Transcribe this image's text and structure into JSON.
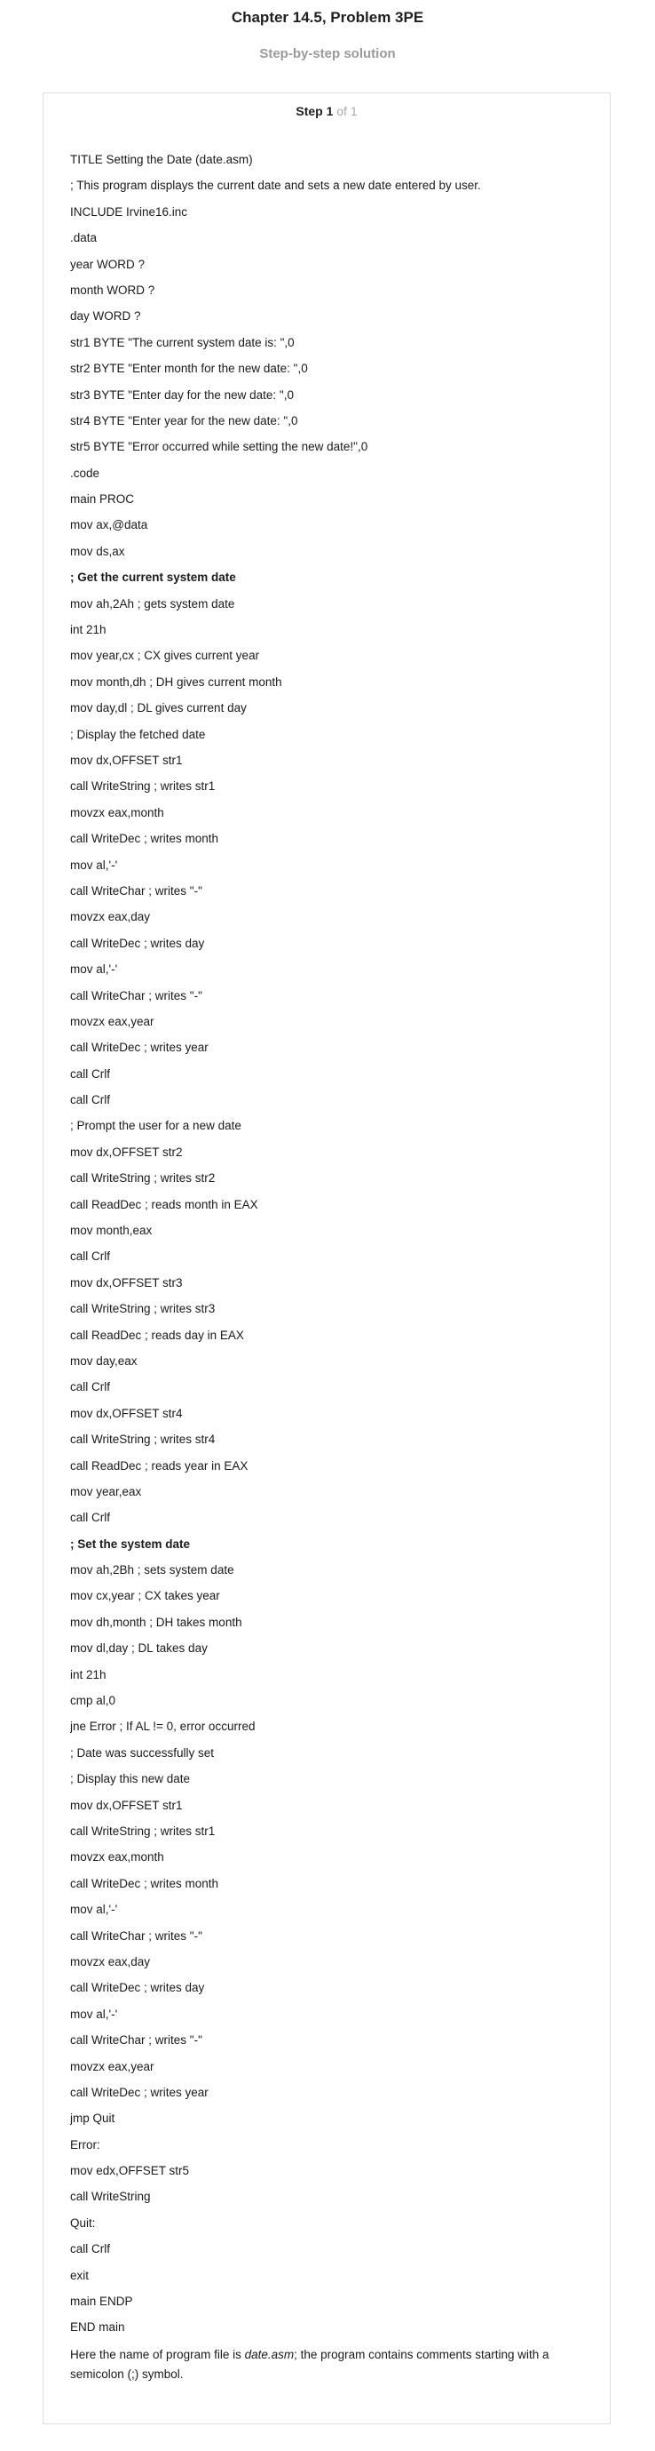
{
  "header": {
    "title": "Chapter 14.5, Problem 3PE",
    "subtitle": "Step-by-step solution"
  },
  "step": {
    "label": "Step 1",
    "of_text": " of 1"
  },
  "code_lines": [
    {
      "text": "TITLE Setting the Date (date.asm)",
      "bold": false
    },
    {
      "text": "; This program displays the current date and sets a new date entered by user.",
      "bold": false
    },
    {
      "text": "INCLUDE Irvine16.inc",
      "bold": false
    },
    {
      "text": ".data",
      "bold": false
    },
    {
      "text": "year WORD ?",
      "bold": false
    },
    {
      "text": "month WORD ?",
      "bold": false
    },
    {
      "text": "day WORD ?",
      "bold": false
    },
    {
      "text": "str1 BYTE \"The current system date is: \",0",
      "bold": false
    },
    {
      "text": "str2 BYTE \"Enter month for the new date: \",0",
      "bold": false
    },
    {
      "text": "str3 BYTE \"Enter day for the new date: \",0",
      "bold": false
    },
    {
      "text": "str4 BYTE \"Enter year for the new date: \",0",
      "bold": false
    },
    {
      "text": "str5 BYTE \"Error occurred while setting the new date!\",0",
      "bold": false
    },
    {
      "text": ".code",
      "bold": false
    },
    {
      "text": "main PROC",
      "bold": false
    },
    {
      "text": "mov ax,@data",
      "bold": false
    },
    {
      "text": "mov ds,ax",
      "bold": false
    },
    {
      "text": "; Get the current system date",
      "bold": true
    },
    {
      "text": "mov ah,2Ah ; gets system date",
      "bold": false
    },
    {
      "text": "int 21h",
      "bold": false
    },
    {
      "text": "mov year,cx ; CX gives current year",
      "bold": false
    },
    {
      "text": "mov month,dh ; DH gives current month",
      "bold": false
    },
    {
      "text": "mov day,dl ; DL gives current day",
      "bold": false
    },
    {
      "text": "; Display the fetched date",
      "bold": false
    },
    {
      "text": "mov dx,OFFSET str1",
      "bold": false
    },
    {
      "text": "call WriteString ; writes str1",
      "bold": false
    },
    {
      "text": "movzx eax,month",
      "bold": false
    },
    {
      "text": "call WriteDec ; writes month",
      "bold": false
    },
    {
      "text": "mov al,'-'",
      "bold": false
    },
    {
      "text": "call WriteChar ; writes \"-\"",
      "bold": false
    },
    {
      "text": "movzx eax,day",
      "bold": false
    },
    {
      "text": "call WriteDec ; writes day",
      "bold": false
    },
    {
      "text": "mov al,'-'",
      "bold": false
    },
    {
      "text": "call WriteChar ; writes \"-\"",
      "bold": false
    },
    {
      "text": "movzx eax,year",
      "bold": false
    },
    {
      "text": "call WriteDec ; writes year",
      "bold": false
    },
    {
      "text": "call Crlf",
      "bold": false
    },
    {
      "text": "call Crlf",
      "bold": false
    },
    {
      "text": "; Prompt the user for a new date",
      "bold": false
    },
    {
      "text": "mov dx,OFFSET str2",
      "bold": false
    },
    {
      "text": "call WriteString ; writes str2",
      "bold": false
    },
    {
      "text": "call ReadDec ; reads month in EAX",
      "bold": false
    },
    {
      "text": "mov month,eax",
      "bold": false
    },
    {
      "text": "call Crlf",
      "bold": false
    },
    {
      "text": "mov dx,OFFSET str3",
      "bold": false
    },
    {
      "text": "call WriteString ; writes str3",
      "bold": false
    },
    {
      "text": "call ReadDec ; reads day in EAX",
      "bold": false
    },
    {
      "text": "mov day,eax",
      "bold": false
    },
    {
      "text": "call Crlf",
      "bold": false
    },
    {
      "text": "mov dx,OFFSET str4",
      "bold": false
    },
    {
      "text": "call WriteString ; writes str4",
      "bold": false
    },
    {
      "text": "call ReadDec ; reads year in EAX",
      "bold": false
    },
    {
      "text": "mov year,eax",
      "bold": false
    },
    {
      "text": "call Crlf",
      "bold": false
    },
    {
      "text": "; Set the system date",
      "bold": true
    },
    {
      "text": "mov ah,2Bh ; sets system date",
      "bold": false
    },
    {
      "text": "mov cx,year ; CX takes year",
      "bold": false
    },
    {
      "text": "mov dh,month ; DH takes month",
      "bold": false
    },
    {
      "text": "mov dl,day ; DL takes day",
      "bold": false
    },
    {
      "text": "int 21h",
      "bold": false
    },
    {
      "text": "cmp al,0",
      "bold": false
    },
    {
      "text": "jne Error ; If AL != 0, error occurred",
      "bold": false
    },
    {
      "text": "; Date was successfully set",
      "bold": false
    },
    {
      "text": "; Display this new date",
      "bold": false
    },
    {
      "text": "mov dx,OFFSET str1",
      "bold": false
    },
    {
      "text": "call WriteString ; writes str1",
      "bold": false
    },
    {
      "text": "movzx eax,month",
      "bold": false
    },
    {
      "text": "call WriteDec ; writes month",
      "bold": false
    },
    {
      "text": "mov al,'-'",
      "bold": false
    },
    {
      "text": "call WriteChar ; writes \"-\"",
      "bold": false
    },
    {
      "text": "movzx eax,day",
      "bold": false
    },
    {
      "text": "call WriteDec ; writes day",
      "bold": false
    },
    {
      "text": "mov al,'-'",
      "bold": false
    },
    {
      "text": "call WriteChar ; writes \"-\"",
      "bold": false
    },
    {
      "text": "movzx eax,year",
      "bold": false
    },
    {
      "text": "call WriteDec ; writes year",
      "bold": false
    },
    {
      "text": "jmp Quit",
      "bold": false
    },
    {
      "text": "Error:",
      "bold": false
    },
    {
      "text": "mov edx,OFFSET str5",
      "bold": false
    },
    {
      "text": "call WriteString",
      "bold": false
    },
    {
      "text": "Quit:",
      "bold": false
    },
    {
      "text": "call Crlf",
      "bold": false
    },
    {
      "text": "exit",
      "bold": false
    },
    {
      "text": "main ENDP",
      "bold": false
    },
    {
      "text": "END main",
      "bold": false
    }
  ],
  "footer": {
    "prefix": "Here the name of program file is ",
    "filename": "date.asm",
    "suffix": "; the program contains comments starting with a semicolon (;) symbol."
  }
}
